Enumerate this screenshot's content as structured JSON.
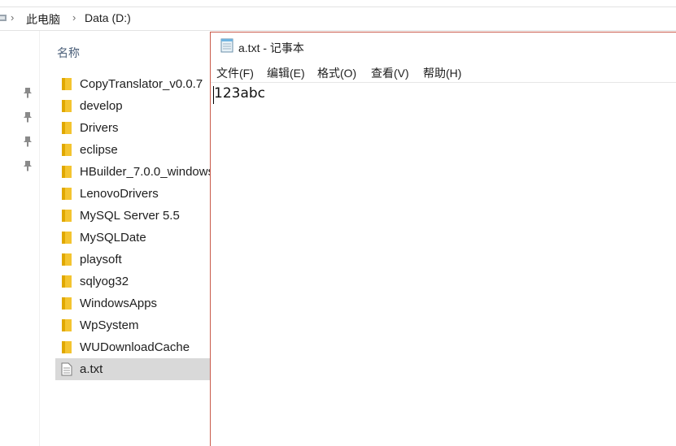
{
  "explorer": {
    "breadcrumb": [
      "此电脑",
      "Data (D:)"
    ],
    "column_header": "名称",
    "items": [
      {
        "name": "CopyTranslator_v0.0.7",
        "type": "folder"
      },
      {
        "name": "develop",
        "type": "folder"
      },
      {
        "name": "Drivers",
        "type": "folder"
      },
      {
        "name": "eclipse",
        "type": "folder"
      },
      {
        "name": "HBuilder_7.0.0_windows",
        "type": "folder"
      },
      {
        "name": "LenovoDrivers",
        "type": "folder"
      },
      {
        "name": "MySQL Server 5.5",
        "type": "folder"
      },
      {
        "name": "MySQLDate",
        "type": "folder"
      },
      {
        "name": "playsoft",
        "type": "folder"
      },
      {
        "name": "sqlyog32",
        "type": "folder"
      },
      {
        "name": "WindowsApps",
        "type": "folder"
      },
      {
        "name": "WpSystem",
        "type": "folder"
      },
      {
        "name": "WUDownloadCache",
        "type": "folder"
      },
      {
        "name": "a.txt",
        "type": "file",
        "selected": true
      }
    ],
    "folder_color": "#f4c430"
  },
  "notepad": {
    "title": "a.txt - 记事本",
    "menu": [
      "文件(F)",
      "编辑(E)",
      "格式(O)",
      "查看(V)",
      "帮助(H)"
    ],
    "content": "123abc",
    "border_color": "#c85a4a"
  }
}
